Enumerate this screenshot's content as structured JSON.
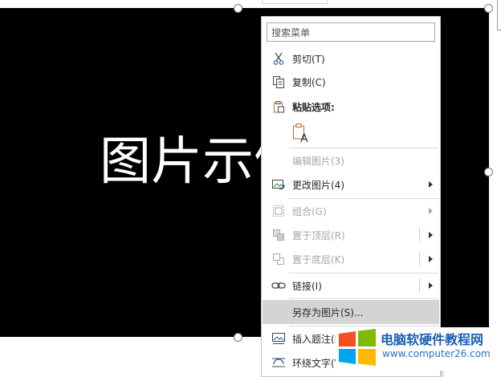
{
  "slide": {
    "text": "图片示例"
  },
  "menu": {
    "search_placeholder": "搜索菜单",
    "items": {
      "cut": "剪切(T)",
      "copy": "复制(C)",
      "paste_options": "粘贴选项:",
      "edit_picture": "编辑图片(3)",
      "change_picture": "更改图片(4)",
      "group": "组合(G)",
      "bring_to_front": "置于顶层(R)",
      "send_to_back": "置于底层(K)",
      "link": "链接(I)",
      "save_as_picture": "另存为图片(S)...",
      "insert_caption": "插入题注(N)",
      "wrap_text": "环绕文字(W)"
    }
  },
  "watermark": {
    "title": "电脑软硬件教程网",
    "url": "www.computer26.com"
  },
  "colors": {
    "accent": "#d04a02",
    "disabled": "#a6a6a6",
    "highlight": "#d4d4d4"
  }
}
